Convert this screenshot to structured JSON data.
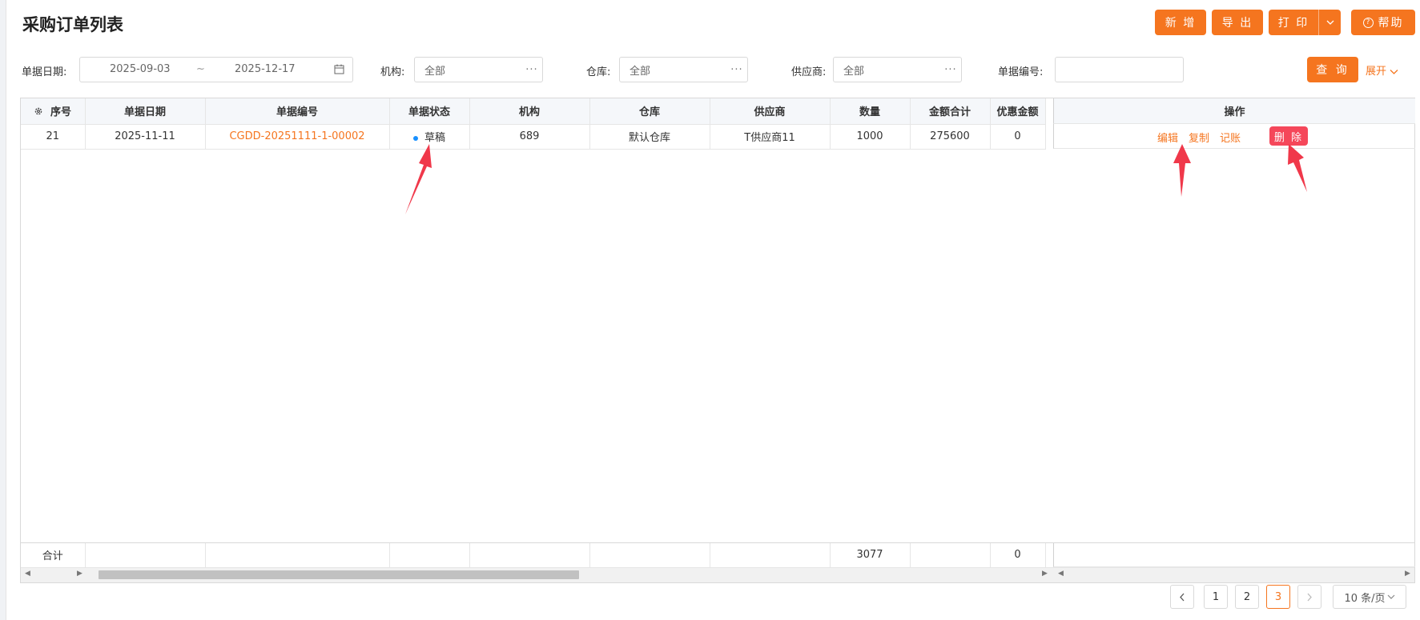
{
  "page": {
    "title": "采购订单列表"
  },
  "toolbar": {
    "new": "新 增",
    "export": "导 出",
    "print": "打 印",
    "help": "帮助"
  },
  "filters": {
    "date_label": "单据日期:",
    "date_start": "2025-09-03",
    "date_sep": "~",
    "date_end": "2025-12-17",
    "org_label": "机构:",
    "org_value": "全部",
    "warehouse_label": "仓库:",
    "warehouse_value": "全部",
    "supplier_label": "供应商:",
    "supplier_value": "全部",
    "docno_label": "单据编号:",
    "docno_value": "",
    "query": "查 询",
    "expand": "展开"
  },
  "table": {
    "columns": [
      "序号",
      "单据日期",
      "单据编号",
      "单据状态",
      "机构",
      "仓库",
      "供应商",
      "数量",
      "金额合计",
      "优惠金额"
    ],
    "ops_header": "操作",
    "rows": [
      {
        "seq": "21",
        "date": "2025-11-11",
        "doc_no": "CGDD-20251111-1-00002",
        "status": "草稿",
        "org": "689",
        "warehouse": "默认仓库",
        "supplier": "T供应商11",
        "qty": "1000",
        "amount": "275600",
        "discount": "0",
        "ops": {
          "edit": "编辑",
          "copy": "复制",
          "post": "记账",
          "delete": "删 除"
        }
      }
    ],
    "footer": {
      "label": "合计",
      "qty": "3077",
      "discount": "0"
    }
  },
  "pagination": {
    "pages": [
      "1",
      "2",
      "3"
    ],
    "current": "3",
    "page_size": "10 条/页"
  },
  "colors": {
    "accent": "#f5751f",
    "danger": "#f5475a",
    "status_dot": "#1890ff",
    "annotation_arrow": "#f0384a"
  }
}
